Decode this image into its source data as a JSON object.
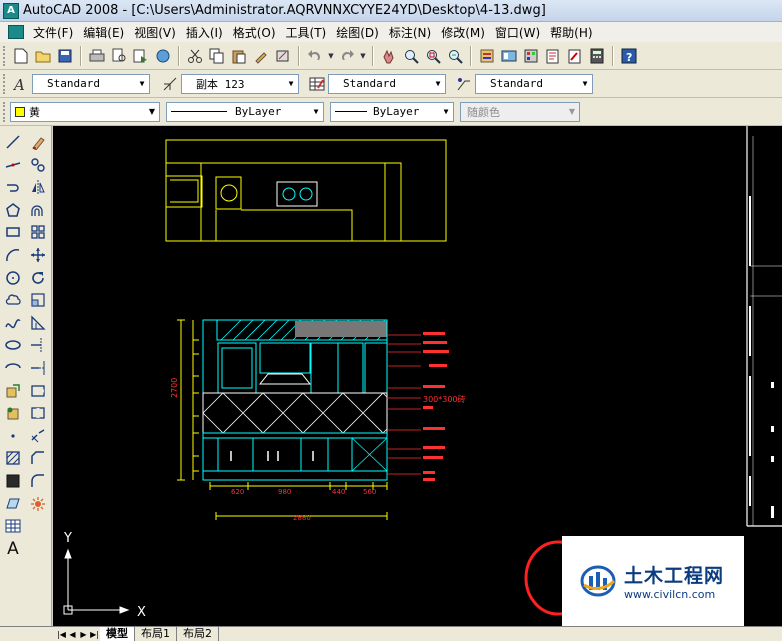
{
  "window": {
    "title": "AutoCAD 2008 - [C:\\Users\\Administrator.AQRVNNXCYYE24YD\\Desktop\\4-13.dwg]",
    "app_icon_glyph": "A"
  },
  "menu": {
    "items": [
      "文件(F)",
      "编辑(E)",
      "视图(V)",
      "插入(I)",
      "格式(O)",
      "工具(T)",
      "绘图(D)",
      "标注(N)",
      "修改(M)",
      "窗口(W)",
      "帮助(H)"
    ]
  },
  "styles_toolbar": {
    "text_style": "Standard",
    "dim_style": "副本 123",
    "table_style": "Standard",
    "mleader_style": "Standard"
  },
  "properties_toolbar": {
    "layer": "黄",
    "layer_color": "#ffff00",
    "linetype": "ByLayer",
    "lineweight": "ByLayer",
    "plot_style": "随颜色"
  },
  "layout_tabs": {
    "tabs": [
      "模型",
      "布局1",
      "布局2"
    ],
    "active": "模型"
  },
  "drawing": {
    "dimensions": {
      "height_total": "2700",
      "tile_size": "300*300砖",
      "widths": [
        "620",
        "980",
        "440",
        "560"
      ],
      "width_total": "2880"
    },
    "ucs": {
      "x": "X",
      "y": "Y"
    },
    "annotation_color": "#ff2020",
    "dimension_color": "#ffff00",
    "outline_color": "#00ffff"
  },
  "watermark": {
    "brand": "土木工程网",
    "url": "www.civilcn.com"
  }
}
